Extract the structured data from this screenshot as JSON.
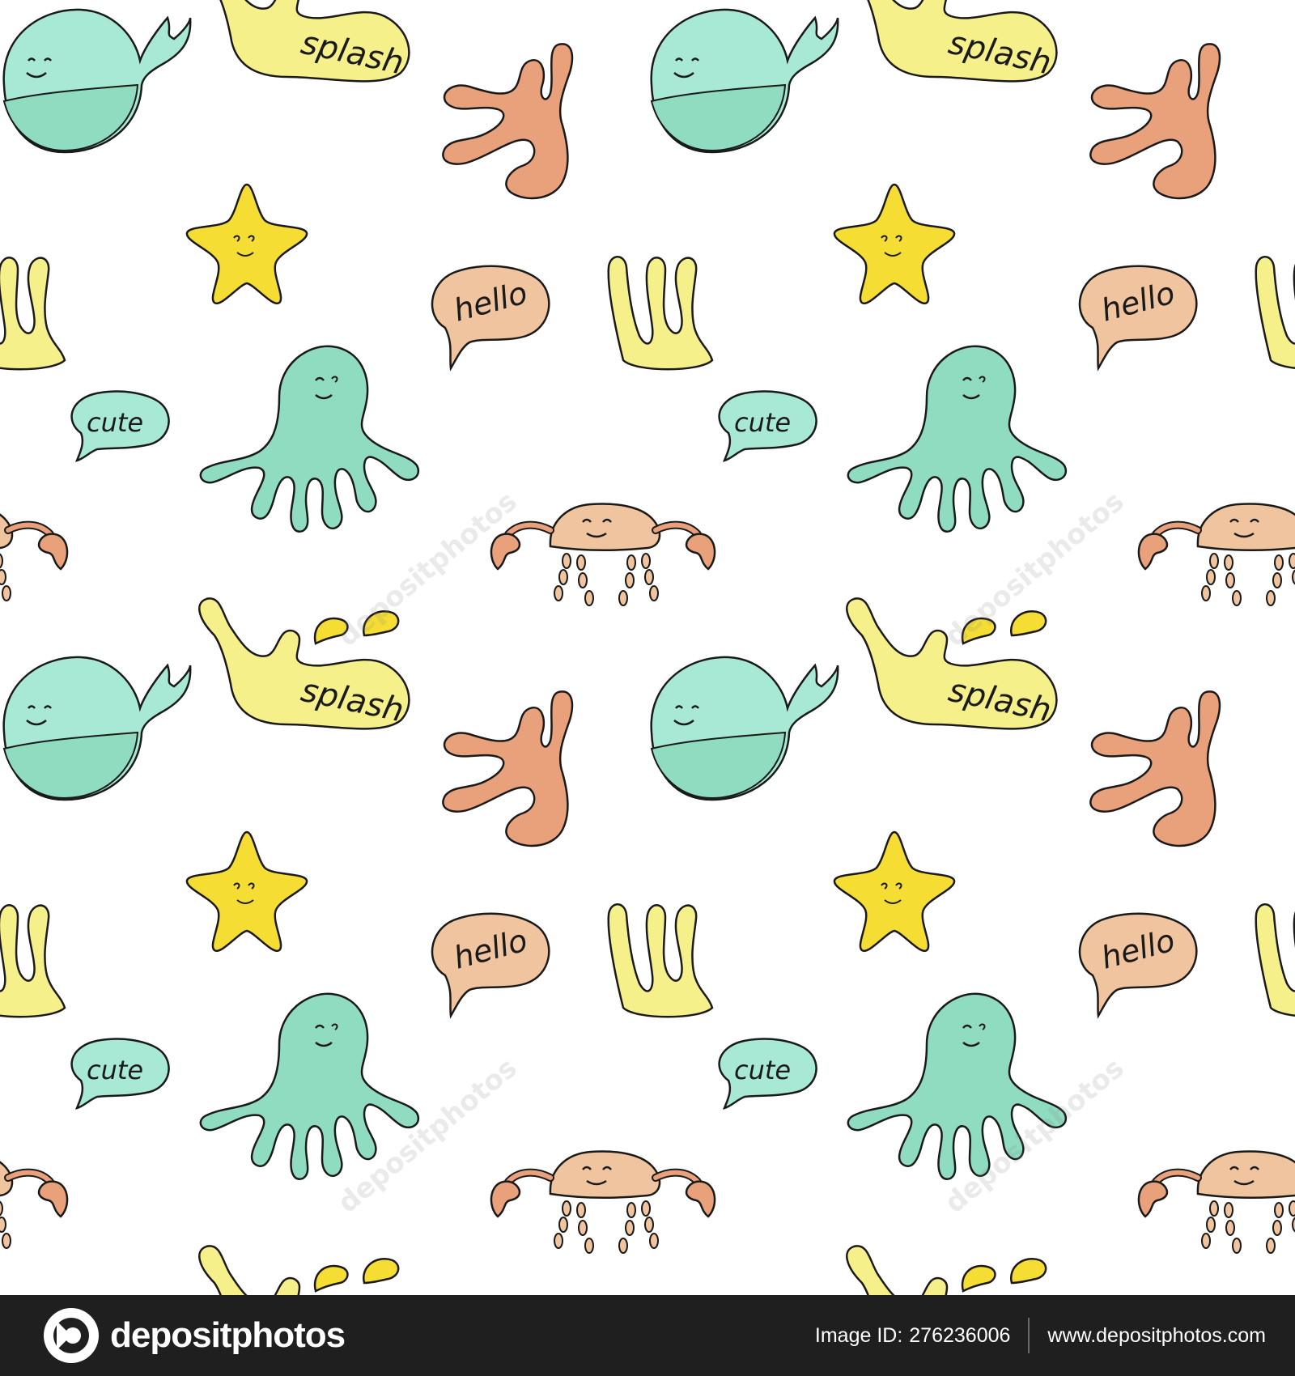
{
  "labels": {
    "splash": "splash",
    "hello": "hello",
    "cute": "cute"
  },
  "watermark": "depositphotos",
  "footer": {
    "brand": "depositphotos",
    "image_id_label": "Image ID:",
    "image_id": "276236006",
    "website": "www.depositphotos.com"
  },
  "colors": {
    "background": "#ffffff",
    "mint": "#a8e9d6",
    "mint_dark": "#8fdcc0",
    "yellow": "#f6f08a",
    "star": "#f5dd34",
    "coral": "#e8a17a",
    "peach": "#efc49e",
    "outline": "#1a1a1a",
    "footer_bg": "#1f1f1f"
  }
}
